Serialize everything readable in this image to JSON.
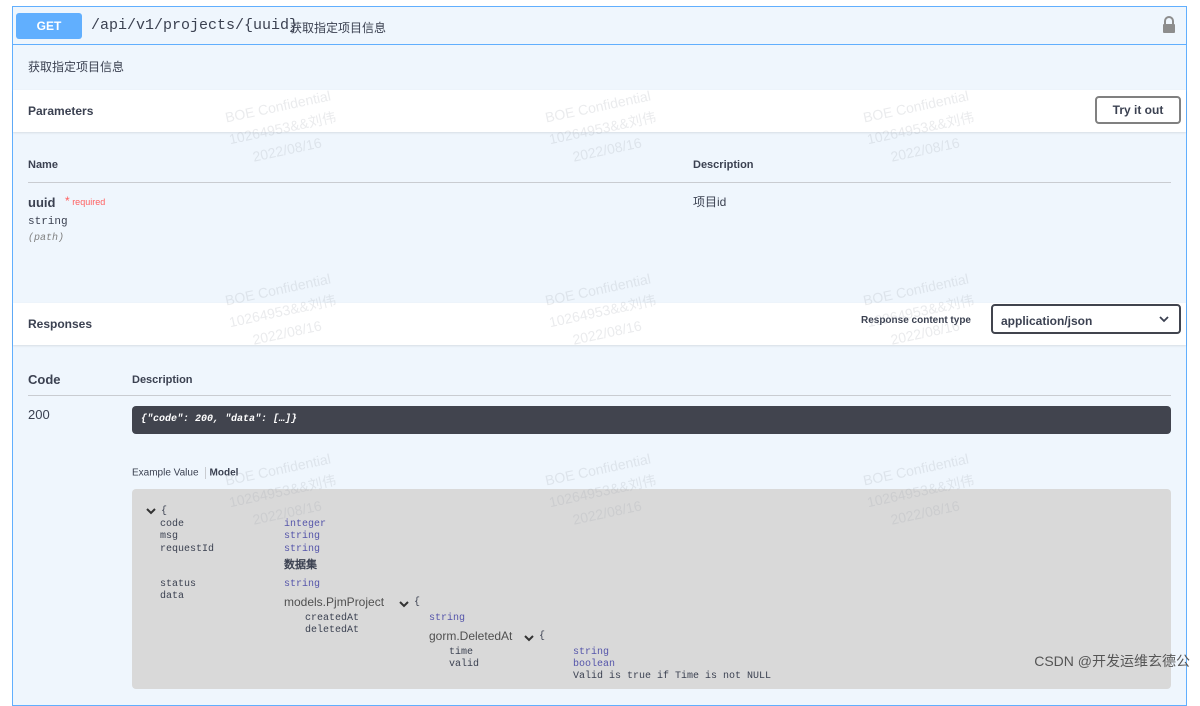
{
  "operation": {
    "method": "GET",
    "path": "/api/v1/projects/{uuid}",
    "summary": "获取指定项目信息",
    "description": "获取指定项目信息"
  },
  "parameters": {
    "title": "Parameters",
    "try_label": "Try it out",
    "col_name": "Name",
    "col_desc": "Description",
    "items": [
      {
        "name": "uuid",
        "required_mark": "*",
        "required_label": "required",
        "type": "string",
        "in": "(path)",
        "description": "项目id"
      }
    ]
  },
  "responses": {
    "title": "Responses",
    "content_type_label": "Response content type",
    "content_type_value": "application/json",
    "col_code": "Code",
    "col_desc": "Description",
    "items": [
      {
        "code": "200",
        "description": "{\"code\": 200, \"data\": […]}"
      }
    ],
    "tab_example": "Example Value",
    "tab_model": "Model"
  },
  "model": {
    "open_brace": "{",
    "rows": [
      {
        "key": "code",
        "type": "integer"
      },
      {
        "key": "msg",
        "type": "string"
      },
      {
        "key": "requestId",
        "type": "string",
        "note": "数据集"
      },
      {
        "key": "status",
        "type": "string"
      },
      {
        "key": "data",
        "ref": "models.PjmProject"
      }
    ],
    "pjm_brace": "{",
    "pjm_rows": [
      {
        "key": "createdAt",
        "type": "string"
      },
      {
        "key": "deletedAt",
        "ref": "gorm.DeletedAt"
      }
    ],
    "deleted_brace": "{",
    "deleted_rows": [
      {
        "key": "time",
        "type": "string"
      },
      {
        "key": "valid",
        "type": "boolean",
        "note": "Valid is true if Time is not NULL"
      }
    ]
  },
  "watermark": {
    "line1": "BOE Confidential",
    "line2": "10264953&&刘伟",
    "line3": "2022/08/16"
  },
  "credit": "CSDN @开发运维玄德公"
}
